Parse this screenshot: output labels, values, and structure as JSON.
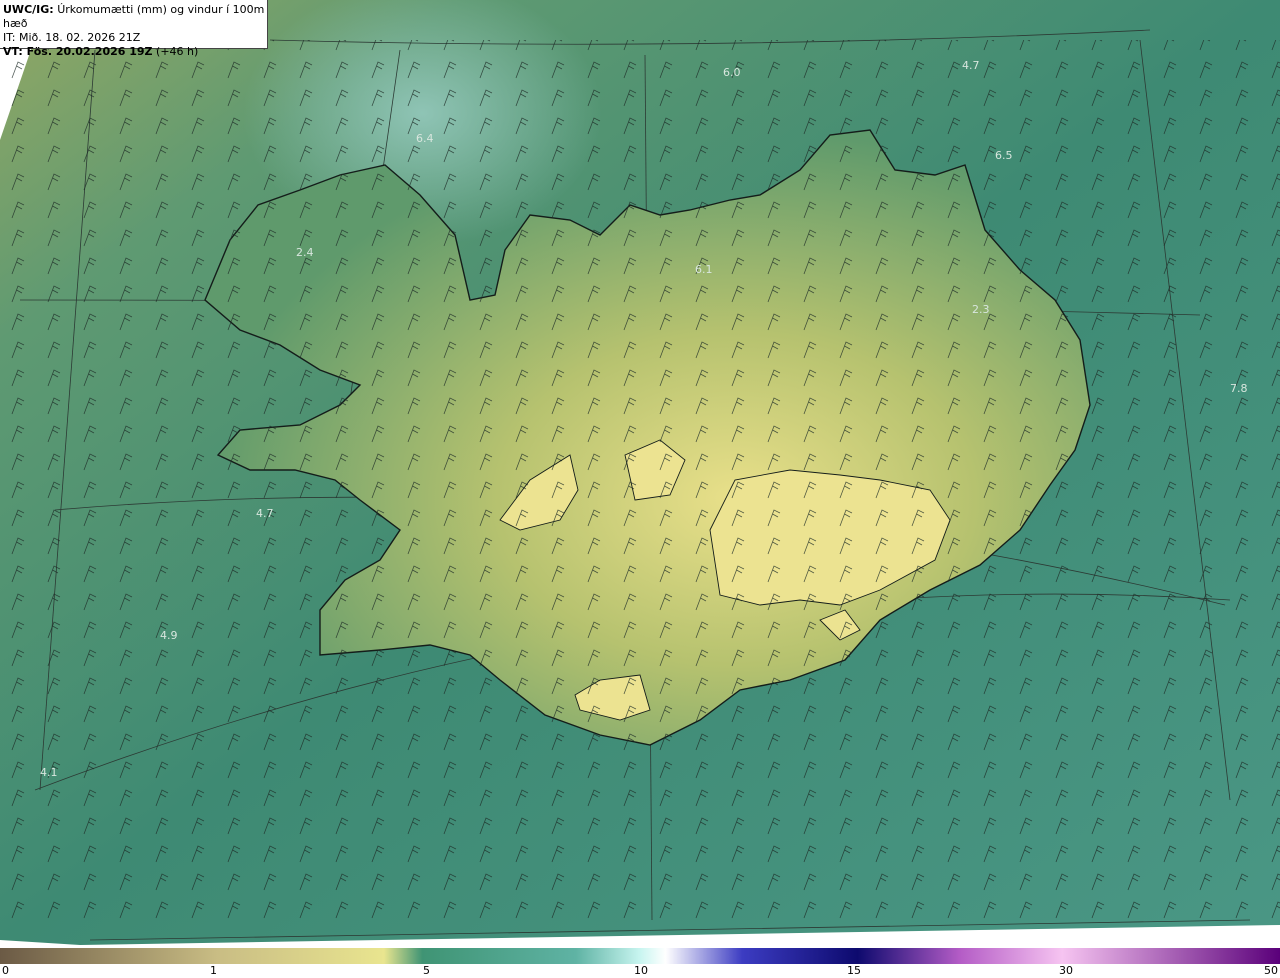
{
  "header": {
    "line1_bold": "UWC/IG:",
    "line1_rest": "Úrkomumætti (mm) og vindur í 100m hæð",
    "line2": "IT: Mið. 18. 02. 2026 21Z",
    "line3_bold": "VT: Fös. 20.02.2026 19Z",
    "line3_rest": "(+46 h)"
  },
  "map": {
    "labels": [
      "6.0",
      "4.7",
      "6.4",
      "6.5",
      "2.4",
      "6.1",
      "2.3",
      "7.8",
      "4.7",
      "4.9",
      "4.1"
    ],
    "colors": {
      "ocean": "#3f8f78",
      "land": "#9fb46a",
      "high": "#e8e38e",
      "coast": "#141d1a",
      "grid": "#2c3a34"
    }
  },
  "colorbar": {
    "ticks": [
      "0",
      "1",
      "5",
      "10",
      "15",
      "30",
      "50"
    ],
    "colors": [
      "#6b5a45",
      "#c9bd84",
      "#e9e58f",
      "#3f9474",
      "#5fb3a4",
      "#c8f5f0",
      "#ffffff",
      "#3c3cc2",
      "#0d0a6e",
      "#b45cc6",
      "#f6c4f1",
      "#5a007a"
    ]
  }
}
